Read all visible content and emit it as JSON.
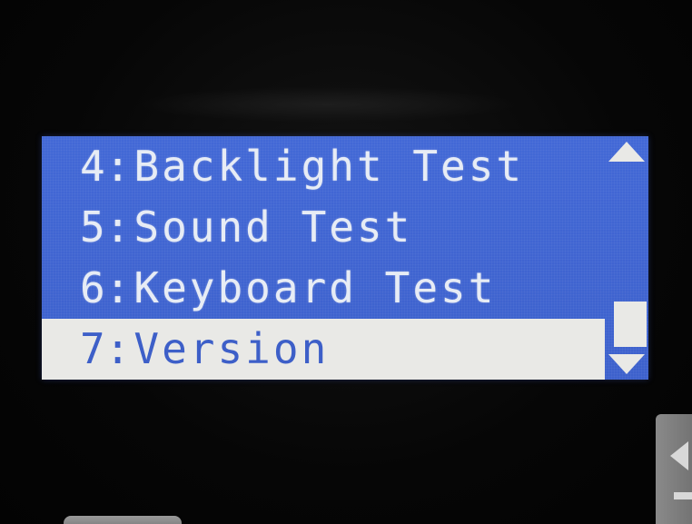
{
  "screen": {
    "colors": {
      "lcd_background": "#3f63cf",
      "text": "#e7ecf5",
      "selection_background": "#e9e9e6",
      "selection_text": "#3d5fc8"
    },
    "menu": {
      "items": [
        {
          "number": "4",
          "separator": ":",
          "label": "Backlight Test",
          "selected": false
        },
        {
          "number": "5",
          "separator": ":",
          "label": "Sound Test",
          "selected": false
        },
        {
          "number": "6",
          "separator": ":",
          "label": "Keyboard Test",
          "selected": false
        },
        {
          "number": "7",
          "separator": ":",
          "label": "Version",
          "selected": true
        }
      ]
    },
    "scrollbar": {
      "up_icon": "triangle-up-icon",
      "down_icon": "triangle-down-icon"
    }
  },
  "hardware_keys": {
    "side_key_icon": "left-arrow-icon"
  }
}
